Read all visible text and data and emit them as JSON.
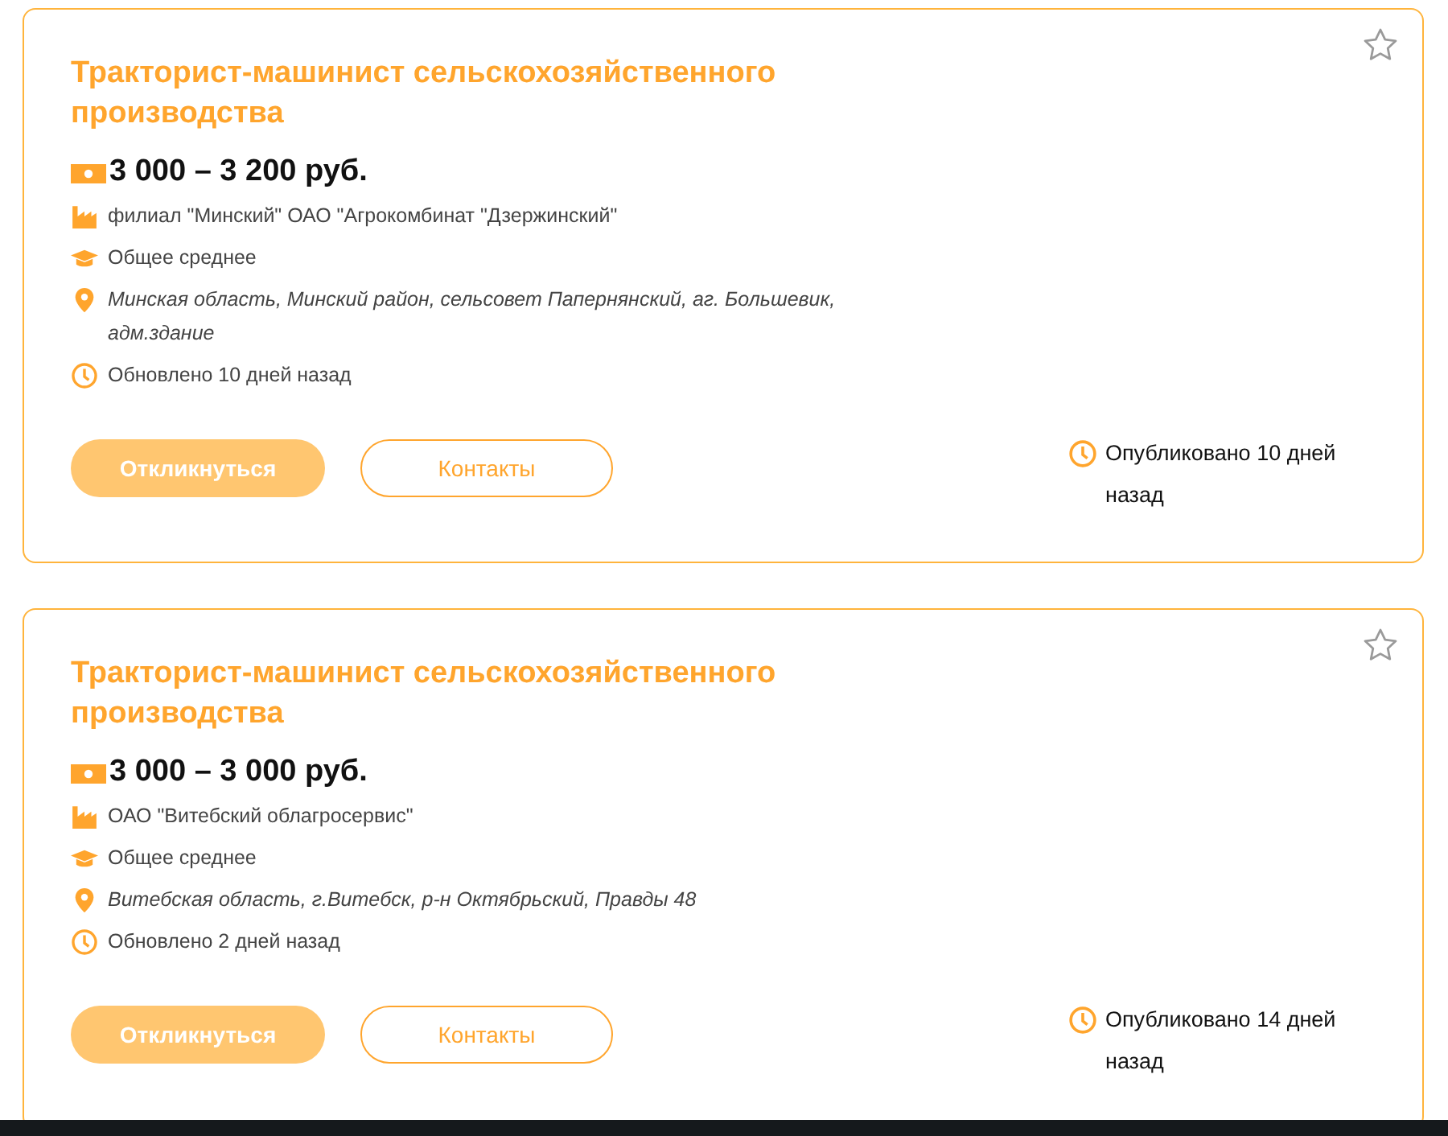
{
  "vacancies": [
    {
      "title": "Тракторист-машинист сельскохозяйственного производства",
      "favorite": false,
      "salary": "3 000 – 3 200 руб.",
      "details": [
        {
          "kind": "company",
          "text": "филиал \"Минский\" ОАО \"Агрокомбинат \"Дзержинский\""
        },
        {
          "kind": "education",
          "text": "Общее среднее"
        },
        {
          "kind": "location",
          "text": "Минская область, Минский район, сельсовет Папернянский, аг. Большевик, адм.здание"
        },
        {
          "kind": "updated",
          "text": "Обновлено 10 дней назад"
        }
      ],
      "apply_button": "Откликнуться",
      "contacts_button": "Контакты",
      "published": "Опубликовано 10 дней назад"
    },
    {
      "title": "Тракторист-машинист сельскохозяйственного производства",
      "favorite": false,
      "salary": "3 000 – 3 000 руб.",
      "details": [
        {
          "kind": "company",
          "text": "ОАО \"Витебский облагросервис\""
        },
        {
          "kind": "education",
          "text": "Общее среднее"
        },
        {
          "kind": "location",
          "text": "Витебская область, г.Витебск, р-н Октябрьский, Правды 48"
        },
        {
          "kind": "updated",
          "text": "Обновлено 2 дней назад"
        }
      ],
      "apply_button": "Откликнуться",
      "contacts_button": "Контакты",
      "published": "Опубликовано 14 дней назад"
    }
  ]
}
